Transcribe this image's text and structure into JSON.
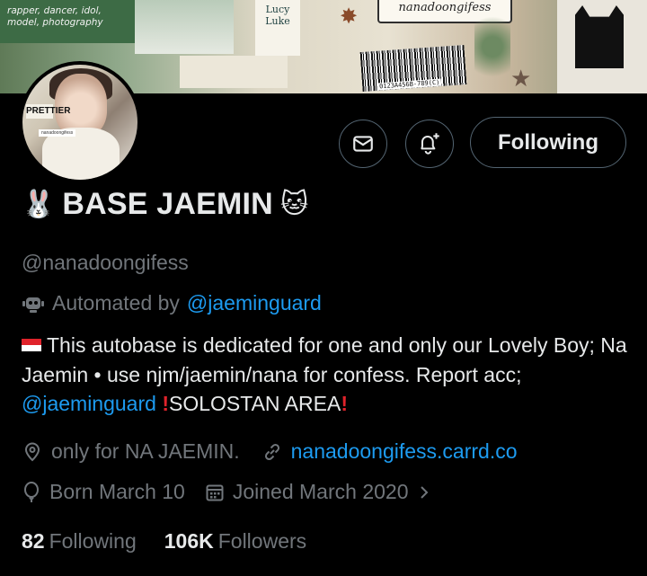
{
  "banner": {
    "note_text": "rapper, dancer, idol, model, photography",
    "card_text": "Lucy Luke",
    "logo_text": "nanadoongifess",
    "barcode_number": "0123A456B-789(C)"
  },
  "avatar": {
    "sticker_text": "PRETTIER",
    "label_text": "nanadoongifess"
  },
  "actions": {
    "follow_label": "Following"
  },
  "profile": {
    "name": "BASE JAEMIN",
    "name_emoji_left": "🐰",
    "name_emoji_right": "🐱",
    "handle": "@nanadoongifess",
    "automated_prefix": "Automated by",
    "automated_link": "@jaeminguard",
    "bio_text_1": "This autobase is dedicated for one and only our Lovely Boy; Na Jaemin • use njm/jaemin/nana for confess. Report acc;",
    "bio_mention": "@jaeminguard",
    "bio_text_2": "SOLOSTAN AREA",
    "bio_excl": "!",
    "location": "only for NA JAEMIN.",
    "website": "nanadoongifess.carrd.co",
    "birthday": "Born March 10",
    "joined": "Joined March 2020"
  },
  "stats": {
    "following_count": "82",
    "following_label": "Following",
    "followers_count": "106K",
    "followers_label": "Followers"
  },
  "icons": [
    "mail-icon",
    "bell-plus-icon",
    "robot-icon",
    "location-icon",
    "link-icon",
    "balloon-icon",
    "calendar-icon",
    "chevron-right-icon"
  ],
  "colors": {
    "background": "#000000",
    "text": "#e7e9ea",
    "secondary": "#71767b",
    "link": "#1d9bf0",
    "border": "#536471",
    "alert": "#e0232b"
  }
}
